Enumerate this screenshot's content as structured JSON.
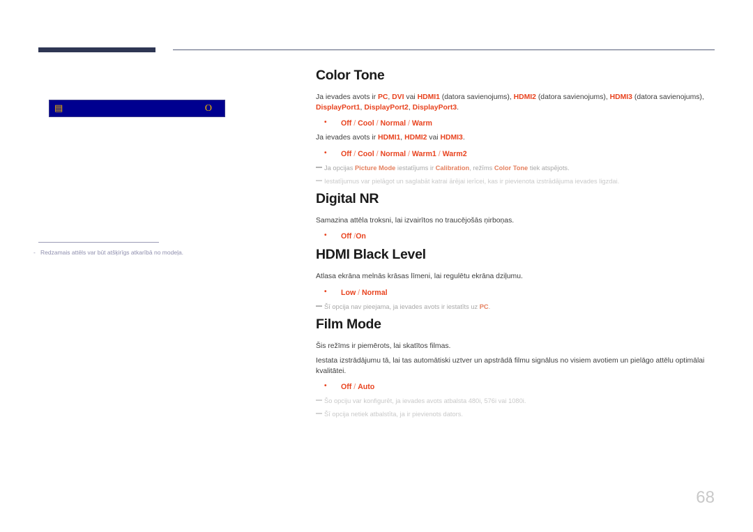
{
  "page": {
    "number": "68",
    "language": "lv"
  },
  "header": {
    "bar_color": "#2e3653",
    "line_color": "#555d78"
  },
  "left_panel": {
    "osd": {
      "icon_name": "menu-lock-icon",
      "icon_glyph": "▤",
      "right_glyph": "O",
      "background_color": "#00008f",
      "foreground_color": "#f0b400"
    },
    "footnote_dash": "-",
    "footnote": "Redzamais attēls var būt atšķirīgs atkarībā no modeļa."
  },
  "sections": [
    {
      "title": "Color Tone",
      "paragraph_1": {
        "p1": "Ja ievades avots ir ",
        "h1": "PC",
        "p2": ", ",
        "h2": "DVI",
        "p3": " vai ",
        "h3": "HDMI1",
        "p4": " (datora savienojums), ",
        "h4": "HDMI2",
        "p5": " (datora savienojums), ",
        "h5": "HDMI3",
        "p6": " (datora savienojums), ",
        "h6": "DisplayPort1",
        "p7": ", ",
        "h7": "DisplayPort2",
        "p8": ", ",
        "h8": "DisplayPort3",
        "p9": "."
      },
      "options_1": {
        "o1": "Off",
        "s1": " / ",
        "o2": "Cool",
        "s2": " / ",
        "o3": "Normal",
        "s3": " / ",
        "o4": "Warm"
      },
      "paragraph_2": {
        "p1": "Ja ievades avots ir ",
        "h1": "HDMI1",
        "p2": ", ",
        "h2": "HDMI2",
        "p3": " vai ",
        "h3": "HDMI3",
        "p4": "."
      },
      "options_2": {
        "o1": "Off",
        "s1": " / ",
        "o2": "Cool",
        "s2": " / ",
        "o3": "Normal",
        "s3": " / ",
        "o4": "Warm1",
        "s4": " / ",
        "o5": "Warm2"
      },
      "note_1": {
        "p1": "Ja opcijas ",
        "h1": "Picture Mode",
        "p2": " iestatījums ir ",
        "h2": "Calibration",
        "p3": ", režīms ",
        "h3": "Color Tone",
        "p4": " tiek atspējots."
      },
      "note_2": {
        "text": "Iestatījumus var pielāgot un saglabāt katrai ārējai ierīcei, kas ir pievienota izstrādājuma ievades ligzdai."
      }
    },
    {
      "title": "Digital NR",
      "paragraph_1": {
        "text": "Samazina attēla troksni, lai izvairītos no traucējošās ņirboņas."
      },
      "options_1": {
        "o1": "Off",
        "s1": " /",
        "o2": "On"
      }
    },
    {
      "title": "HDMI Black Level",
      "paragraph_1": {
        "text": "Atlasa ekrāna melnās krāsas līmeni, lai regulētu ekrāna dziļumu."
      },
      "options_1": {
        "o1": "Low",
        "s1": " / ",
        "o2": "Normal"
      },
      "note_1": {
        "p1": "Šī opcija nav pieejama, ja ievades avots ir iestatīts uz ",
        "h1": "PC",
        "p2": "."
      }
    },
    {
      "title": "Film Mode",
      "paragraph_1": {
        "text": "Šis režīms ir piemērots, lai skatītos filmas."
      },
      "paragraph_2": {
        "text": "Iestata izstrādājumu tā, lai tas automātiski uztver un apstrādā filmu signālus no visiem avotiem un pielāgo attēlu optimālai kvalitātei."
      },
      "options_1": {
        "o1": "Off",
        "s1": " / ",
        "o2": "Auto"
      },
      "note_1": {
        "text": "Šo opciju var konfigurēt, ja ievades avots atbalsta 480i, 576i vai 1080i."
      },
      "note_2": {
        "text": "Šī opcija netiek atbalstīta, ja ir pievienots dators."
      }
    }
  ]
}
